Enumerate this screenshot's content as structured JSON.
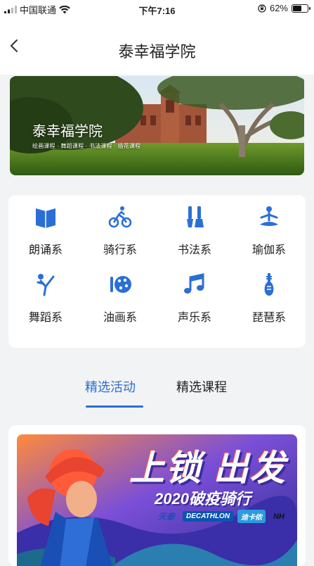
{
  "status_bar": {
    "carrier": "中国联通",
    "time": "下午7:16",
    "battery": "62%",
    "battery_level": 0.62
  },
  "nav": {
    "title": "泰幸福学院"
  },
  "banner": {
    "title": "泰幸福学院",
    "subtitle": "绘画课程 · 舞蹈课程 · 书法课程 · 插花课程"
  },
  "categories": [
    {
      "label": "朗诵系",
      "icon": "book-icon"
    },
    {
      "label": "骑行系",
      "icon": "cycling-icon"
    },
    {
      "label": "书法系",
      "icon": "brush-icon"
    },
    {
      "label": "瑜伽系",
      "icon": "yoga-icon"
    },
    {
      "label": "舞蹈系",
      "icon": "dance-icon"
    },
    {
      "label": "油画系",
      "icon": "palette-icon"
    },
    {
      "label": "声乐系",
      "icon": "music-note-icon"
    },
    {
      "label": "琵琶系",
      "icon": "pipa-icon"
    }
  ],
  "tabs": [
    {
      "label": "精选活动",
      "active": true
    },
    {
      "label": "精选课程",
      "active": false
    }
  ],
  "activity": {
    "headline": "上锁 出发",
    "subheadline": "2020破疫骑行",
    "brands": [
      "天泰",
      "DECATHLON",
      "迪卡侬",
      "NH"
    ]
  },
  "colors": {
    "accent": "#2a6fd6",
    "background": "#f2f3f5",
    "card": "#ffffff"
  }
}
